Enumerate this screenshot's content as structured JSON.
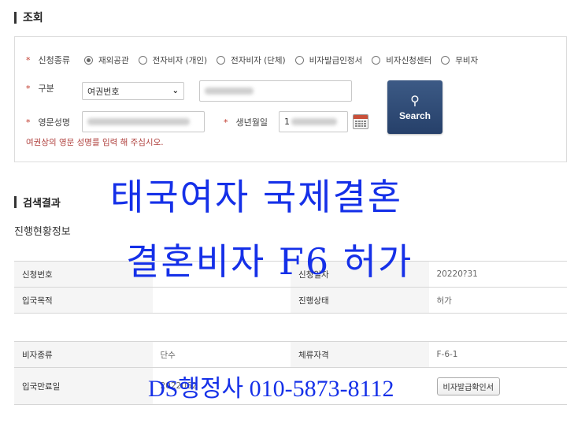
{
  "inquiry": {
    "title": "조회",
    "application_type": {
      "label": "신청종류",
      "options": [
        {
          "label": "재외공관",
          "checked": true
        },
        {
          "label": "전자비자 (개인)",
          "checked": false
        },
        {
          "label": "전자비자 (단체)",
          "checked": false
        },
        {
          "label": "비자발급인정서",
          "checked": false
        },
        {
          "label": "비자신청센터",
          "checked": false
        },
        {
          "label": "무비자",
          "checked": false
        }
      ]
    },
    "category": {
      "label": "구분",
      "selected": "여권번호"
    },
    "english_name": {
      "label": "영문성명"
    },
    "birth_date": {
      "label": "생년월일",
      "visible_prefix": "1"
    },
    "hint": "여권상의 영문 성명를 입력 해 주십시오.",
    "search_button": {
      "label": "Search",
      "icon": "search-icon"
    },
    "required_mark": "*"
  },
  "results": {
    "title": "검색결과",
    "subtitle": "진행현황정보",
    "table1": [
      [
        {
          "h": "신청번호"
        },
        {
          "v": ""
        },
        {
          "h": "신청일자"
        },
        {
          "v": "20220?31"
        }
      ],
      [
        {
          "h": "입국목적"
        },
        {
          "v": ""
        },
        {
          "h": "진행상태"
        },
        {
          "v": "허가"
        }
      ]
    ],
    "table2": [
      [
        {
          "h": "비자종류"
        },
        {
          "v": "단수"
        },
        {
          "h": "체류자격"
        },
        {
          "v": "F-6-1"
        }
      ],
      [
        {
          "h": "입국만료일"
        },
        {
          "v": "2022062"
        },
        {
          "h": ""
        },
        {
          "v": ""
        }
      ]
    ],
    "doc_button": "비자발급확인서"
  },
  "overlay": {
    "line1": "태국여자 국제결혼",
    "line2": "결혼비자 F6 허가",
    "line3": "DS행정사 010-5873-8112",
    "color": "#1530e8"
  }
}
